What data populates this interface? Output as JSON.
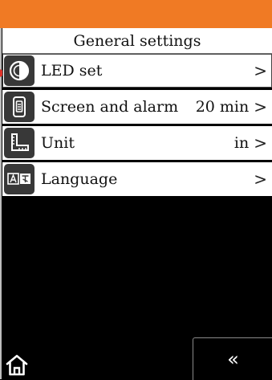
{
  "header": {
    "accent_color": "#f07a24",
    "title": "General settings"
  },
  "menu": {
    "items": [
      {
        "icon": "led-circle-icon",
        "label": "LED set",
        "value": "",
        "chevron": ">"
      },
      {
        "icon": "screen-timer-icon",
        "label": "Screen and alarm",
        "value": "20 min",
        "chevron": ">"
      },
      {
        "icon": "ruler-unit-icon",
        "label": "Unit",
        "value": "in",
        "chevron": ">"
      },
      {
        "icon": "language-ab-icon",
        "label": "Language",
        "value": "",
        "chevron": ">"
      }
    ]
  },
  "footer": {
    "home_icon": "home-icon",
    "back_label": "«"
  }
}
